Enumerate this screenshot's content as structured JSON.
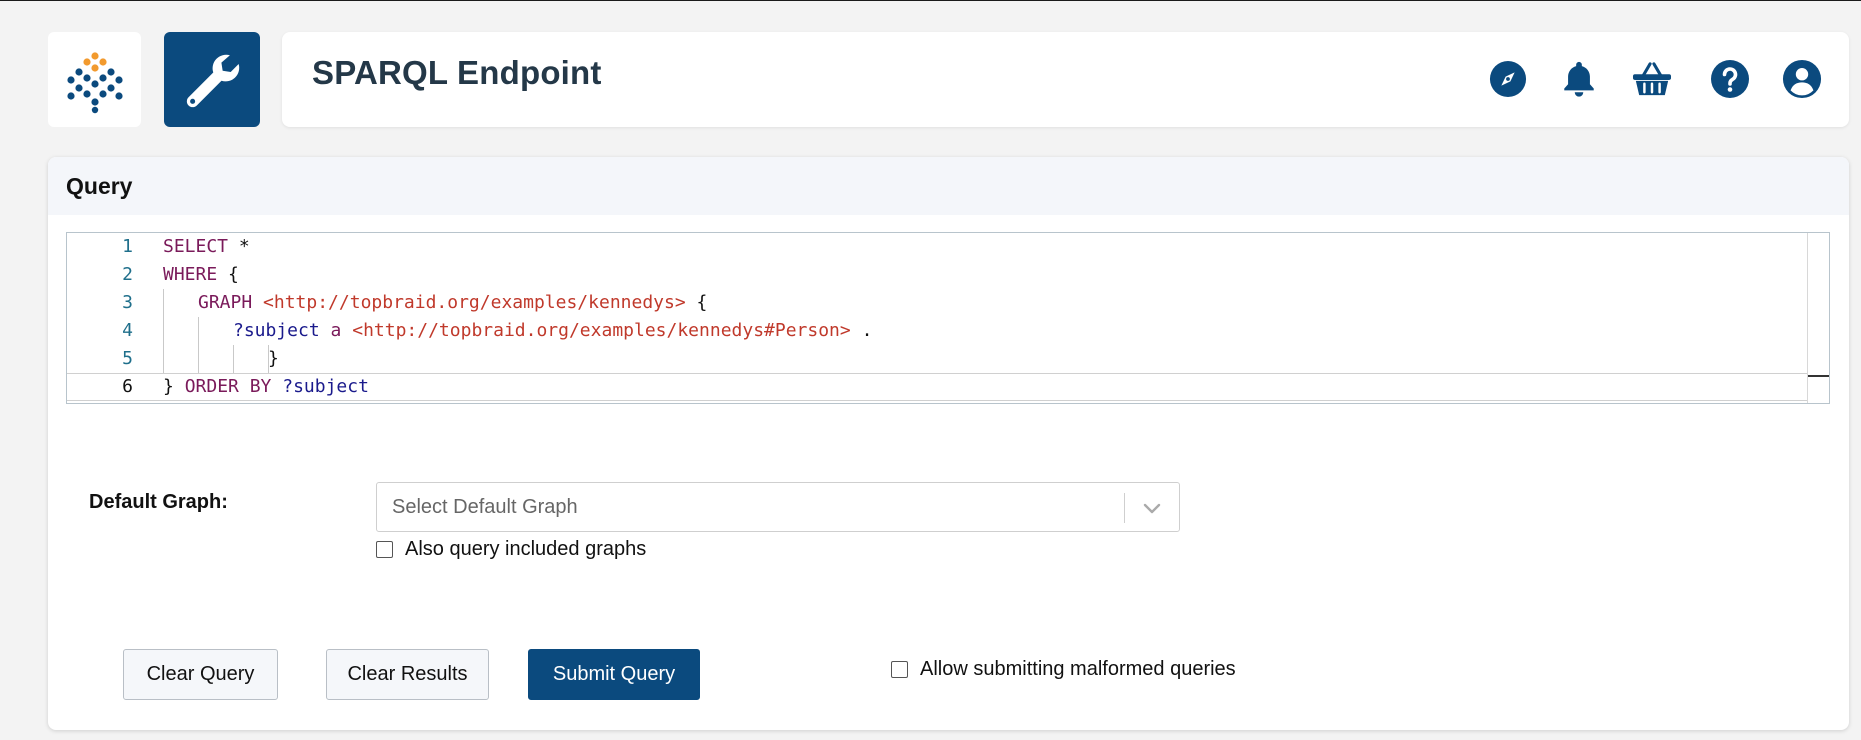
{
  "header": {
    "title": "SPARQL Endpoint"
  },
  "icons": {
    "logo": "topbraid-logo",
    "tool": "wrench-icon",
    "header_icons": [
      "compass-icon",
      "bell-icon",
      "basket-icon",
      "help-icon",
      "user-icon"
    ]
  },
  "colors": {
    "brand_blue": "#0b4a7e",
    "logo_orange": "#f29a2e",
    "keyword": "#7a1a5a",
    "uri": "#c0392b",
    "variable": "#1a1a8c",
    "line_number": "#1f6f8b"
  },
  "query_panel": {
    "title": "Query",
    "editor": {
      "line_numbers": [
        "1",
        "2",
        "3",
        "4",
        "5",
        "6"
      ],
      "current_line": "6",
      "lines": [
        [
          {
            "t": "kw",
            "v": "SELECT"
          },
          {
            "t": "pl",
            "v": " *"
          }
        ],
        [
          {
            "t": "kw",
            "v": "WHERE"
          },
          {
            "t": "pl",
            "v": " {"
          }
        ],
        [
          {
            "t": "kw",
            "v": "GRAPH"
          },
          {
            "t": "pl",
            "v": " "
          },
          {
            "t": "uri",
            "v": "<http://topbraid.org/examples/kennedys>"
          },
          {
            "t": "pl",
            "v": " {"
          }
        ],
        [
          {
            "t": "var",
            "v": "?subject"
          },
          {
            "t": "pl",
            "v": " "
          },
          {
            "t": "kw",
            "v": "a"
          },
          {
            "t": "pl",
            "v": " "
          },
          {
            "t": "uri",
            "v": "<http://topbraid.org/examples/kennedys#Person>"
          },
          {
            "t": "pl",
            "v": " ."
          }
        ],
        [
          {
            "t": "pl",
            "v": "}"
          }
        ],
        [
          {
            "t": "pl",
            "v": "} "
          },
          {
            "t": "kw",
            "v": "ORDER BY"
          },
          {
            "t": "pl",
            "v": " "
          },
          {
            "t": "var",
            "v": "?subject"
          }
        ]
      ]
    },
    "default_graph": {
      "label": "Default Graph:",
      "placeholder": "Select Default Graph",
      "include_label": "Also query included graphs",
      "include_checked": false
    },
    "buttons": {
      "clear_query": "Clear Query",
      "clear_results": "Clear Results",
      "submit_query": "Submit Query"
    },
    "malformed": {
      "label": "Allow submitting malformed queries",
      "checked": false
    }
  }
}
